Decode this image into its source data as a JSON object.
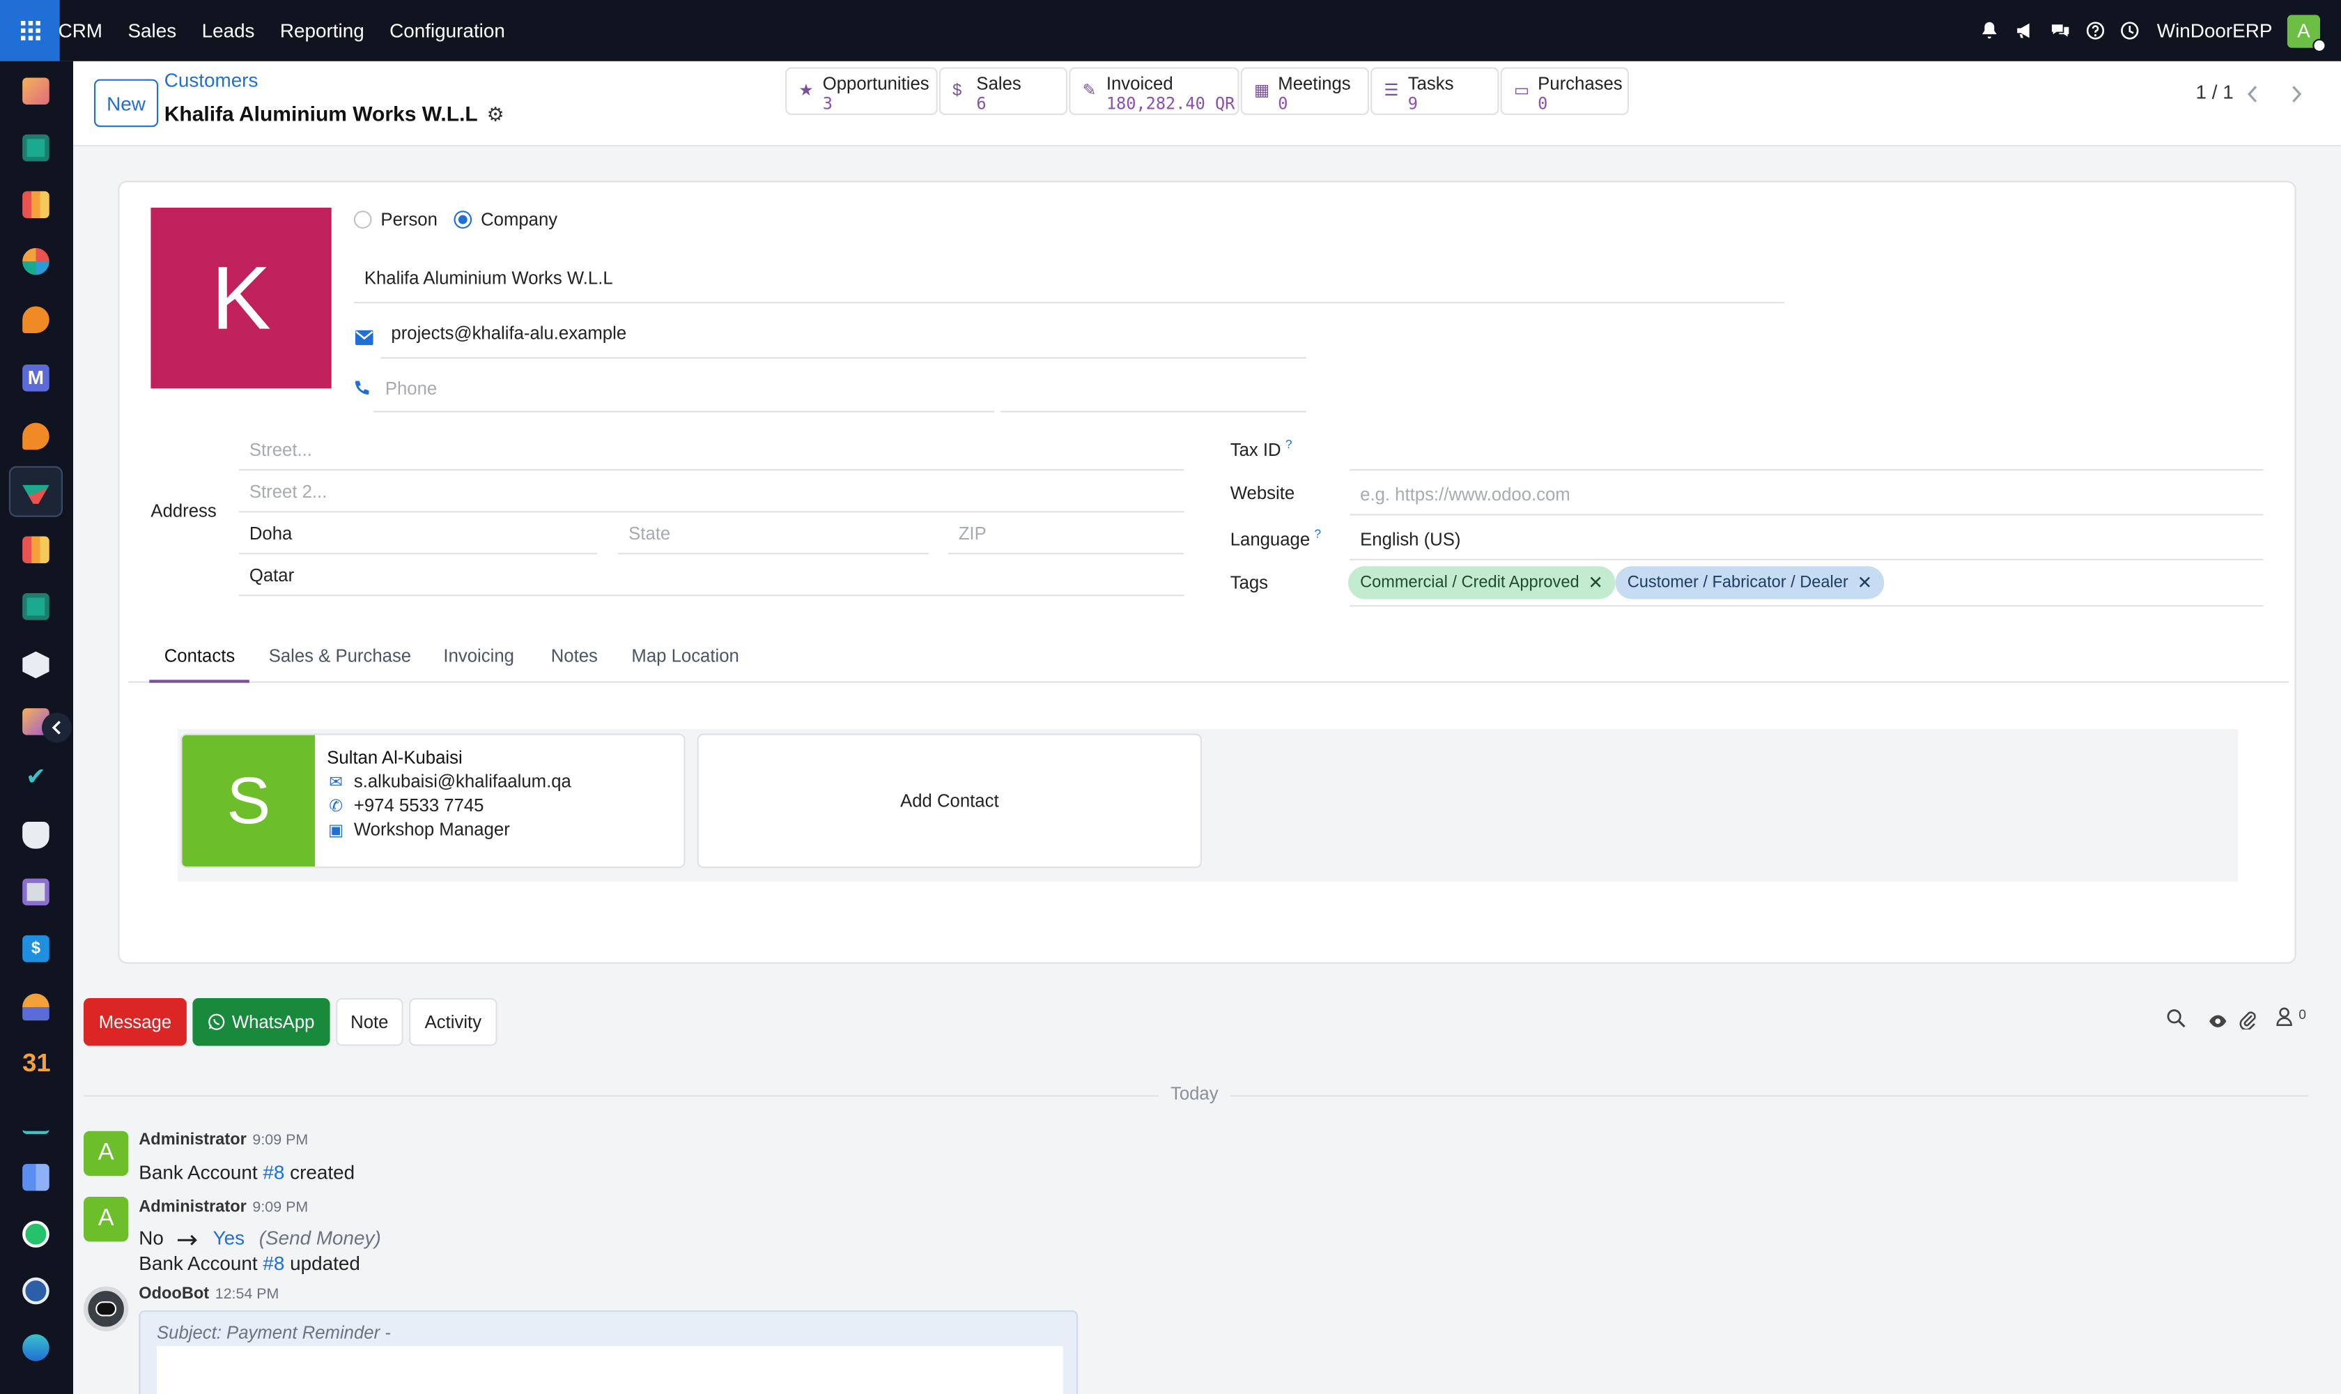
{
  "topbar": {
    "menu": [
      "CRM",
      "Sales",
      "Leads",
      "Reporting",
      "Configuration"
    ],
    "company": "WinDoorERP",
    "user_initial": "A",
    "icons": [
      "bell-icon",
      "megaphone-icon",
      "chat-icon",
      "help-icon",
      "clock-icon"
    ]
  },
  "sidebar": {
    "apps": [
      "discuss-app",
      "contacts-app",
      "reporting-app",
      "dashboard-app",
      "livechat-app",
      "mail-marketing-app",
      "chat-app",
      "crm-app",
      "sales-report-app",
      "employees-app",
      "inventory-app",
      "surveys-app",
      "project-app",
      "knowledge-app",
      "product-app",
      "invoicing-app",
      "team-app",
      "calendar-app",
      "sign-app",
      "dashboards-app",
      "whatsapp-app",
      "timesheets-app",
      "website-app"
    ],
    "calendar_label": "31",
    "invoice_label": "$"
  },
  "control": {
    "new_label": "New",
    "breadcrumb_parent": "Customers",
    "record_title": "Khalifa Aluminium Works W.L.L",
    "pager": "1 / 1",
    "smart_buttons": [
      {
        "label": "Opportunities",
        "value": "3",
        "icon": "star-icon"
      },
      {
        "label": "Sales",
        "value": "6",
        "icon": "dollar-icon"
      },
      {
        "label": "Invoiced",
        "value": "180,282.40 QR",
        "icon": "pencil-square-icon"
      },
      {
        "label": "Meetings",
        "value": "0",
        "icon": "calendar-icon"
      },
      {
        "label": "Tasks",
        "value": "9",
        "icon": "tasks-icon"
      },
      {
        "label": "Purchases",
        "value": "0",
        "icon": "credit-card-icon"
      }
    ]
  },
  "form": {
    "avatar_initial": "K",
    "type_person": "Person",
    "type_company": "Company",
    "name": "Khalifa Aluminium Works W.L.L",
    "email": "projects@khalifa-alu.example",
    "phone_placeholder": "Phone",
    "address_label": "Address",
    "street_placeholder": "Street...",
    "street2_placeholder": "Street 2...",
    "city": "Doha",
    "state_placeholder": "State",
    "zip_placeholder": "ZIP",
    "country": "Qatar",
    "tax_id_label": "Tax ID",
    "website_label": "Website",
    "website_placeholder": "e.g. https://www.odoo.com",
    "language_label": "Language",
    "language": "English (US)",
    "tags_label": "Tags",
    "tags": [
      {
        "label": "Commercial / Credit Approved",
        "color": "#c3ebce"
      },
      {
        "label": "Customer / Fabricator / Dealer",
        "color": "#c5dcf3"
      }
    ],
    "help_mark": "?"
  },
  "tabs": [
    "Contacts",
    "Sales & Purchase",
    "Invoicing",
    "Notes",
    "Map Location"
  ],
  "contacts": {
    "cards": [
      {
        "initial": "S",
        "name": "Sultan Al-Kubaisi",
        "email": "s.alkubaisi@khalifaalum.qa",
        "phone": "+974 5533 7745",
        "job": "Workshop Manager"
      }
    ],
    "add_label": "Add Contact"
  },
  "chatter": {
    "buttons": {
      "message": "Message",
      "whatsapp": "WhatsApp",
      "note": "Note",
      "activity": "Activity"
    },
    "follower_count": "0",
    "today_label": "Today",
    "messages": [
      {
        "initial": "A",
        "author": "Administrator",
        "time": "9:09 PM",
        "text_before": "Bank Account ",
        "link": "#8",
        "text_after": " created"
      },
      {
        "initial": "A",
        "author": "Administrator",
        "time": "9:09 PM",
        "old_value": "No",
        "new_value": "Yes",
        "field": "(Send Money)",
        "text_before": "Bank Account ",
        "link": "#8",
        "text_after": " updated"
      },
      {
        "author": "OdooBot",
        "time": "12:54 PM",
        "subject": "Subject: Payment Reminder -"
      }
    ]
  },
  "colors": {
    "brand": "#1f6fd6",
    "message_button": "#dc2626",
    "whatsapp_button": "#198a3c",
    "company_avatar": "#c0215a",
    "contact_avatar": "#6cbf2a"
  }
}
